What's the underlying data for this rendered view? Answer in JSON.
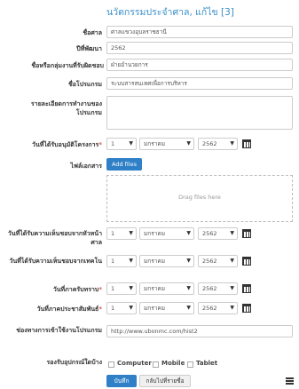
{
  "title": "นวัตกรรมประจำศาล, แก้ไข [3]",
  "fields": {
    "court_name": {
      "label": "ชื่อศาล",
      "value": "ศาลแขวงอุบลราชธานี"
    },
    "year": {
      "label": "ปีที่พัฒนา",
      "value": "2562"
    },
    "group_name": {
      "label": "ชื่อหรือกลุ่มงานที่รับผิดชอบ",
      "value": "ฝ่ายอำนวยการ"
    },
    "program_name": {
      "label": "ชื่อโปรแกรม",
      "value": "ระบบสารสนเทศเพื่อการบริหาร"
    },
    "details": {
      "label": "รายละเอียดการทำงานของโปรแกรม",
      "value": ""
    },
    "approve_date": {
      "label": "วันที่ได้รับอนุมัติโครงการ",
      "day": "1",
      "month": "มกราคม",
      "year": "2562"
    },
    "documents": {
      "label": "ไฟล์เอกสาร",
      "add_files": "Add files",
      "drop_text": "Drag files here"
    },
    "chief_date": {
      "label": "วันที่ได้รับความเห็นชอบจากหัวหน้าศาล",
      "day": "1",
      "month": "มกราคม",
      "year": "2562"
    },
    "it_date": {
      "label": "วันที่ได้รับความเห็นชอบจากเทคโน",
      "day": "1",
      "month": "มกราคม",
      "year": "2562"
    },
    "region_date": {
      "label": "วันที่ภาครับทราบ",
      "day": "1",
      "month": "มกราคม",
      "year": "2562"
    },
    "pr_date": {
      "label": "วันที่ภาคประชาสัมพันธ์",
      "day": "1",
      "month": "มกราคม",
      "year": "2562"
    },
    "access_url": {
      "label": "ช่องทางการเข้าใช้งานโปรแกรม",
      "value": "http://www.ubonmc.com/hist2"
    },
    "devices": {
      "label": "รองรับอุปกรณ์ใดบ้าง",
      "options": [
        "Computer",
        "Mobile",
        "Tablet"
      ]
    }
  },
  "required_mark": "*",
  "actions": {
    "save": "บันทึก",
    "back": "กลับไปที่รายชื่อ"
  },
  "colors": {
    "accent": "#2f80c6",
    "title": "#3a8fc9",
    "required": "#d9534f"
  }
}
